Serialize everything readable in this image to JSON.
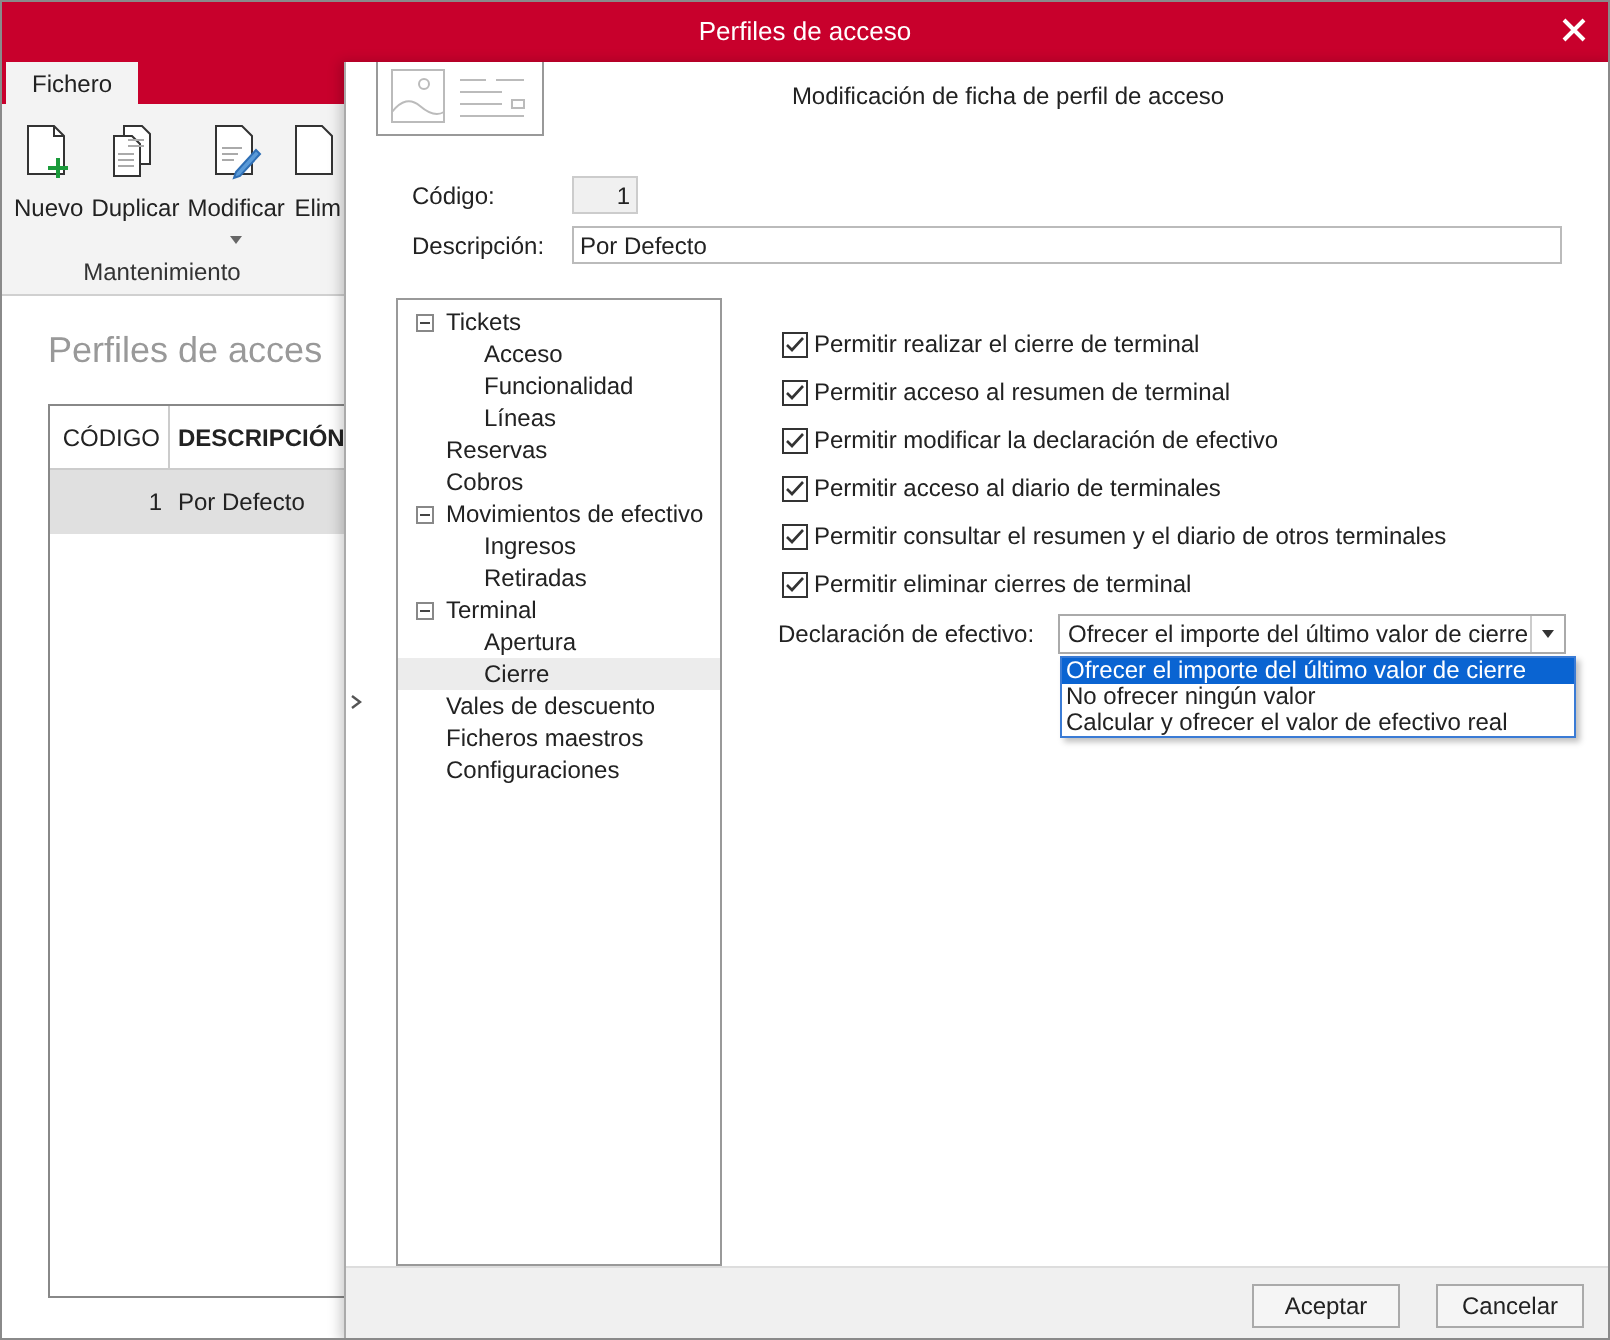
{
  "window": {
    "title": "Perfiles de acceso"
  },
  "ribbon": {
    "tabs": [
      {
        "label": "Fichero",
        "selected": true
      }
    ],
    "buttons": [
      {
        "label": "Nuevo",
        "kind": "new",
        "dropdown": false
      },
      {
        "label": "Duplicar",
        "kind": "duplicate",
        "dropdown": false
      },
      {
        "label": "Modificar",
        "kind": "edit",
        "dropdown": true
      },
      {
        "label": "Elim",
        "kind": "plain",
        "dropdown": false
      }
    ],
    "group": "Mantenimiento"
  },
  "page": {
    "title": "Perfiles de acces",
    "table": {
      "columns": [
        "CÓDIGO",
        "DESCRIPCIÓN"
      ],
      "rows": [
        {
          "cells": [
            "1",
            "Por Defecto"
          ],
          "selected": true
        }
      ]
    }
  },
  "dialog": {
    "title": "Modificación de ficha de perfil de acceso",
    "fields": [
      {
        "label": "Código:",
        "value": "1",
        "kind": "code"
      },
      {
        "label": "Descripción:",
        "value": "Por Defecto",
        "kind": "text"
      }
    ],
    "tree": [
      {
        "label": "Tickets",
        "expanded": true,
        "selected": false,
        "children": [
          {
            "label": "Acceso",
            "selected": false
          },
          {
            "label": "Funcionalidad",
            "selected": false
          },
          {
            "label": "Líneas",
            "selected": false
          }
        ]
      },
      {
        "label": "Reservas",
        "selected": false
      },
      {
        "label": "Cobros",
        "selected": false
      },
      {
        "label": "Movimientos de efectivo",
        "expanded": true,
        "selected": false,
        "children": [
          {
            "label": "Ingresos",
            "selected": false
          },
          {
            "label": "Retiradas",
            "selected": false
          }
        ]
      },
      {
        "label": "Terminal",
        "expanded": true,
        "selected": false,
        "children": [
          {
            "label": "Apertura",
            "selected": false
          },
          {
            "label": "Cierre",
            "selected": true
          }
        ]
      },
      {
        "label": "Vales de descuento",
        "selected": false
      },
      {
        "label": "Ficheros maestros",
        "selected": false
      },
      {
        "label": "Configuraciones",
        "selected": false
      }
    ],
    "checkboxes": [
      {
        "label": "Permitir realizar el cierre de terminal",
        "checked": true
      },
      {
        "label": "Permitir acceso al resumen de terminal",
        "checked": true
      },
      {
        "label": "Permitir modificar la declaración de efectivo",
        "checked": true
      },
      {
        "label": "Permitir acceso al diario de terminales",
        "checked": true
      },
      {
        "label": "Permitir consultar el resumen y el diario de otros terminales",
        "checked": true
      },
      {
        "label": "Permitir eliminar cierres de terminal",
        "checked": true
      }
    ],
    "combo": {
      "label": "Declaración de efectivo:",
      "value": "Ofrecer el importe del último valor de cierre",
      "expanded": true,
      "options": [
        {
          "label": "Ofrecer el importe del último valor de cierre",
          "selected": true
        },
        {
          "label": "No ofrecer ningún valor",
          "selected": false
        },
        {
          "label": "Calcular y ofrecer el valor de efectivo real",
          "selected": false
        }
      ]
    },
    "buttons": [
      "Aceptar",
      "Cancelar"
    ]
  }
}
